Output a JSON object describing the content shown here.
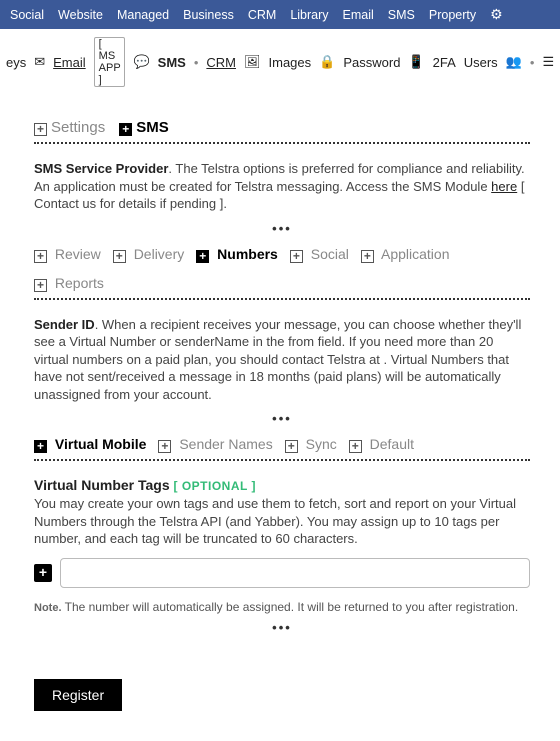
{
  "topnav": {
    "items": [
      "Social",
      "Website",
      "Managed",
      "Business",
      "CRM",
      "Library",
      "Email",
      "SMS",
      "Property"
    ]
  },
  "secondnav": {
    "keys": "eys",
    "email": "Email",
    "msapp": "MS APP",
    "sms": "SMS",
    "crm": "CRM",
    "images": "Images",
    "password": "Password",
    "twofa": "2FA",
    "users": "Users"
  },
  "breadcrumb": {
    "settings": "Settings",
    "sms": "SMS"
  },
  "provider": {
    "label": "SMS Service Provider",
    "text1": ". The Telstra options is preferred for compliance and reliability. An application must be created for Telstra messaging. Access the SMS Module ",
    "link": "here",
    "text2": " [ Contact us for details if pending ]."
  },
  "tabs1": {
    "items": [
      "Review",
      "Delivery",
      "Numbers",
      "Social",
      "Application",
      "Reports"
    ],
    "activeIndex": 2
  },
  "sender": {
    "label": "Sender ID",
    "text": ". When a recipient receives your message, you can choose whether they'll see a Virtual Number or senderName in the from field. If you need more than 20 virtual numbers on a paid plan, you should contact Telstra at . Virtual Numbers that have not sent/received a message in 18 months (paid plans) will be automatically unassigned from your account."
  },
  "tabs2": {
    "items": [
      "Virtual Mobile",
      "Sender Names",
      "Sync",
      "Default"
    ],
    "activeIndex": 0
  },
  "vnt": {
    "title": "Virtual Number Tags",
    "optional": "[ OPTIONAL ]",
    "desc": "You may create your own tags and use them to fetch, sort and report on your Virtual Numbers through the Telstra API (and Yabber). You may assign up to 10 tags per number, and each tag will be truncated to 60 characters.",
    "input_value": "",
    "input_placeholder": ""
  },
  "note": {
    "label": "Note.",
    "text": " The number will automatically be assigned. It will be returned to you after registration."
  },
  "buttons": {
    "register": "Register"
  }
}
